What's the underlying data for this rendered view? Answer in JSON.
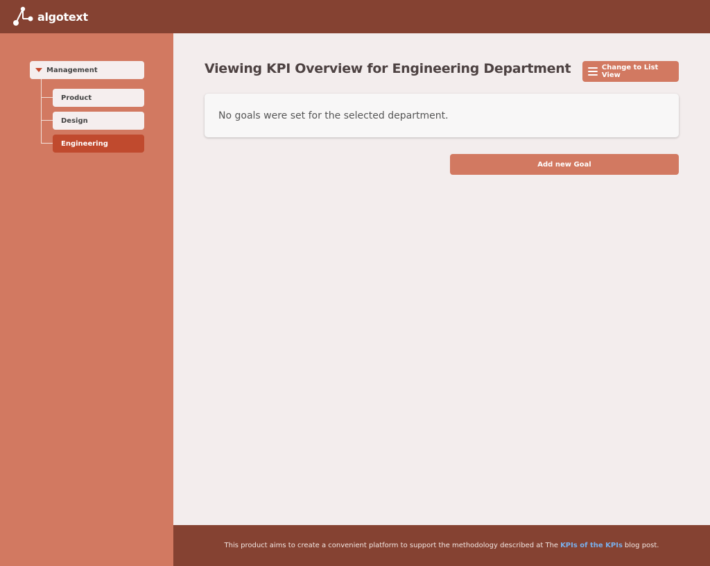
{
  "header": {
    "logo_text": "algotext"
  },
  "sidebar": {
    "root": {
      "label": "Management",
      "icon": "caret-down-icon"
    },
    "children": [
      {
        "label": "Product",
        "active": false
      },
      {
        "label": "Design",
        "active": false
      },
      {
        "label": "Engineering",
        "active": true
      }
    ]
  },
  "main": {
    "title": "Viewing KPI Overview for Engineering Department",
    "list_view_button": {
      "label": "Change to List View",
      "icon": "menu-icon"
    },
    "empty_message": "No goals were set for the selected department.",
    "add_goal_button": "Add new Goal"
  },
  "footer": {
    "text_before": "This product aims to create a convenient platform to support the methodology described at The",
    "link_text": "KPIs of the KPIs",
    "text_after": "blog post."
  },
  "colors": {
    "header_bg": "#854232",
    "sidebar_bg": "#d27961",
    "active_item": "#c04a2e",
    "main_bg": "#f3eded",
    "accent_button": "#d27961",
    "link": "#7ab0ec"
  }
}
